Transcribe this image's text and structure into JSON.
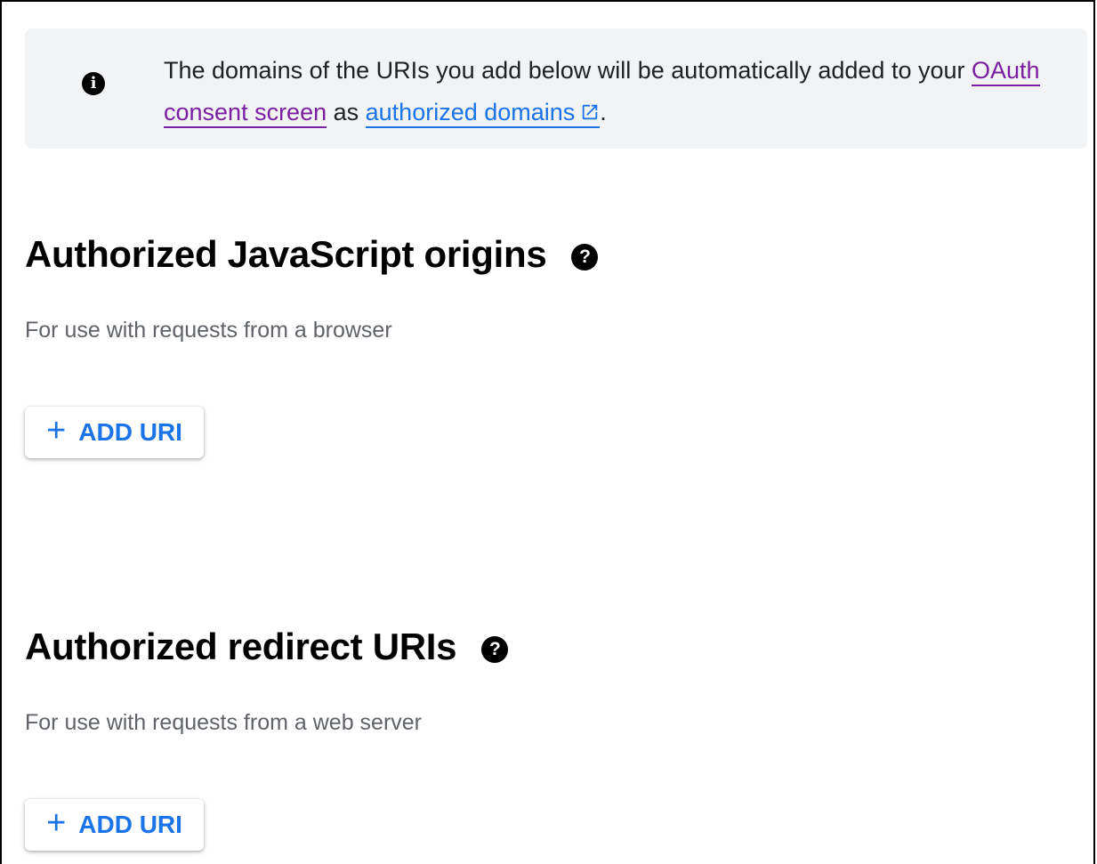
{
  "banner": {
    "text_before": "The domains of the URIs you add below will be automatically added to your ",
    "link1": "OAuth consent screen",
    "text_middle": " as ",
    "link2": "authorized domains",
    "text_after": "."
  },
  "icons": {
    "info": "info-icon",
    "help": "help-icon",
    "external_link": "external-link-icon",
    "plus": "plus-icon"
  },
  "colors": {
    "banner_bg": "#f1f3f4",
    "link_visited": "#7b1fa2",
    "link": "#1a73e8",
    "button_text": "#1a73e8",
    "subtitle": "#5f6368"
  },
  "js_origins": {
    "title": "Authorized JavaScript origins",
    "subtitle": "For use with requests from a browser",
    "add_label": "ADD URI"
  },
  "redirect_uris": {
    "title": "Authorized redirect URIs",
    "subtitle": "For use with requests from a web server",
    "add_label": "ADD URI"
  }
}
